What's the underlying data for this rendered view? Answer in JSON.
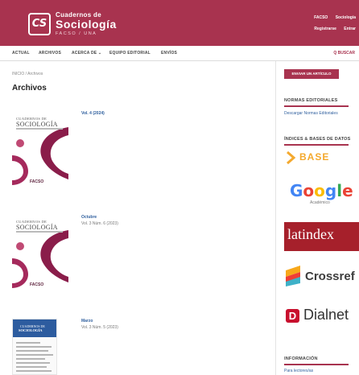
{
  "header": {
    "logo_mark": "CS",
    "logo_line1": "Cuadernos de",
    "logo_line2": "Sociología",
    "logo_line3": "FACSO / UNA",
    "user_nav_top": [
      "FACSO",
      "Sociología"
    ],
    "user_nav_bottom": [
      "Registrarse",
      "Entrar"
    ]
  },
  "nav": {
    "items": [
      "ACTUAL",
      "ARCHIVOS",
      "ACERCA DE ⌄",
      "EQUIPO EDITORIAL",
      "ENVÍOS"
    ],
    "search": "Q BUSCAR"
  },
  "main": {
    "breadcrumb": "INICIO / Archivos",
    "title": "Archivos",
    "issues": [
      {
        "title": "Vol. 4 (2024)",
        "subtitle": "",
        "cover_title1": "CUADERNOS DE",
        "cover_title2": "SOCIOLOGÍA",
        "cover_logo": "FACSO"
      },
      {
        "title": "Octubre",
        "subtitle": "Vol. 3 Núm. 6 (2023)",
        "cover_title1": "CUADERNOS DE",
        "cover_title2": "SOCIOLOGÍA",
        "cover_logo": "FACSO"
      },
      {
        "title": "Marzo",
        "subtitle": "Vol. 3 Núm. 5 (2023)",
        "cover_title1": "CUADERNOS DE",
        "cover_title2": "SOCIOLOGÍA"
      }
    ]
  },
  "sidebar": {
    "submit_button": "ENVIAR UN ARTÍCULO",
    "normas_heading": "NORMAS EDITORIALES",
    "normas_link": "Descargar Normas Editoriales",
    "indices_heading": "ÍNDICES & BASES DE DATOS",
    "logos": {
      "base": "BASE",
      "google": "Google",
      "google_sub": "Académico",
      "latindex": "latindex",
      "crossref": "Crossref",
      "dialnet": "Dialnet"
    },
    "info_heading": "INFORMACIÓN",
    "info_link": "Para lectores/as"
  },
  "colors": {
    "brand": "#a8334f",
    "link": "#2f5f9e"
  }
}
